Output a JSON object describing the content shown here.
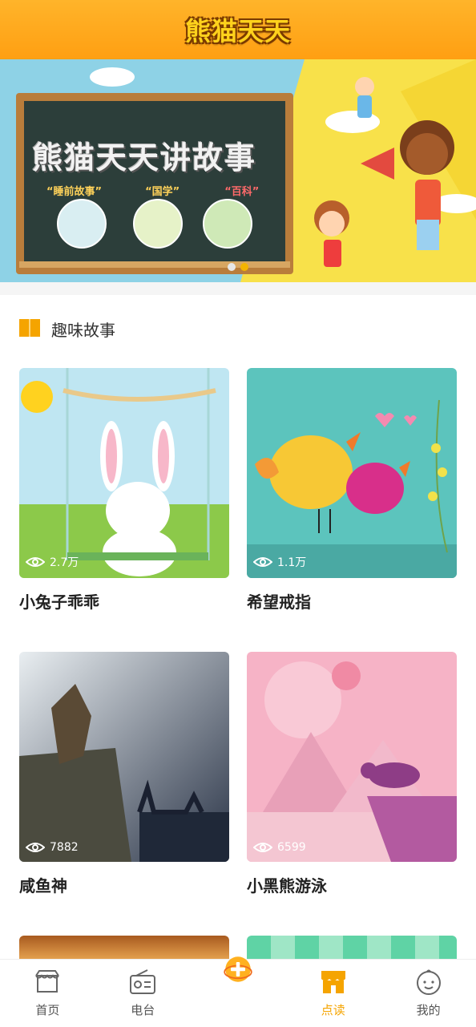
{
  "app": {
    "title": "熊猫天天"
  },
  "banner": {
    "headline": "熊猫天天讲故事",
    "categories": [
      "“睡前故事”",
      "“国学”",
      "“百科”"
    ],
    "slides": 2,
    "active_slide": 2
  },
  "section": {
    "title": "趣味故事"
  },
  "stories": [
    {
      "title": "小兔子乖乖",
      "views": "2.7万"
    },
    {
      "title": "希望戒指",
      "views": "1.1万"
    },
    {
      "title": "咸鱼神",
      "views": "7882"
    },
    {
      "title": "小黑熊游泳",
      "views": "6599"
    }
  ],
  "tabbar": {
    "items": [
      {
        "label": "首页",
        "icon": "shop-icon"
      },
      {
        "label": "电台",
        "icon": "radio-icon"
      },
      {
        "label": "",
        "icon": "add-icon"
      },
      {
        "label": "点读",
        "icon": "store-icon"
      },
      {
        "label": "我的",
        "icon": "baby-face-icon"
      }
    ],
    "active_index": 3
  },
  "colors": {
    "accent": "#f5a400",
    "header": "#ffa81a"
  }
}
